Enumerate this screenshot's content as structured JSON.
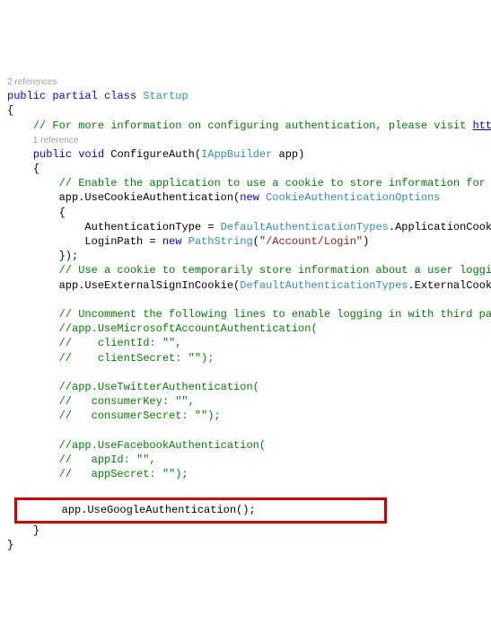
{
  "codelens": {
    "class_refs": "2 references",
    "method_refs": "1 reference"
  },
  "sig": {
    "kw_public1": "public",
    "kw_partial": "partial",
    "kw_class": "class",
    "class_name": "Startup",
    "kw_public2": "public",
    "kw_void": "void",
    "method_name": "ConfigureAuth",
    "param_type": "IAppBuilder",
    "param_name": " app"
  },
  "comments": {
    "c1": "// For more information on configuring authentication, please visit ",
    "c1_link": "http:",
    "c2": "// Enable the application to use a cookie to store information for th",
    "c3": "// Use a cookie to temporarily store information about a user logging",
    "c4": "// Uncomment the following lines to enable logging in with third part",
    "ms1": "//app.UseMicrosoftAccountAuthentication(",
    "ms2": "//    clientId: \"\",",
    "ms3": "//    clientSecret: \"\");",
    "tw1": "//app.UseTwitterAuthentication(",
    "tw2": "//   consumerKey: \"\",",
    "tw3": "//   consumerSecret: \"\");",
    "fb1": "//app.UseFacebookAuthentication(",
    "fb2": "//   appId: \"\",",
    "fb3": "//   appSecret: \"\");"
  },
  "code": {
    "brace_open": "{",
    "brace_close": "}",
    "paren_close": ")",
    "cookie_call1": "app.UseCookieAuthentication(",
    "kw_new": "new",
    "cookie_type": "CookieAuthenticationOptions",
    "authtype_lhs": "AuthenticationType = ",
    "authtype_rhs_type": "DefaultAuthenticationTypes",
    "authtype_rhs_member": ".ApplicationCookie",
    "loginpath_lhs": "LoginPath = ",
    "pathstring_type": "PathString",
    "loginpath_string": "\"/Account/Login\"",
    "close_cookie": "});",
    "ext_call": "app.UseExternalSignInCookie(",
    "ext_arg_type": "DefaultAuthenticationTypes",
    "ext_arg_member": ".ExternalCookie",
    "google_call": "app.UseGoogleAuthentication();"
  }
}
